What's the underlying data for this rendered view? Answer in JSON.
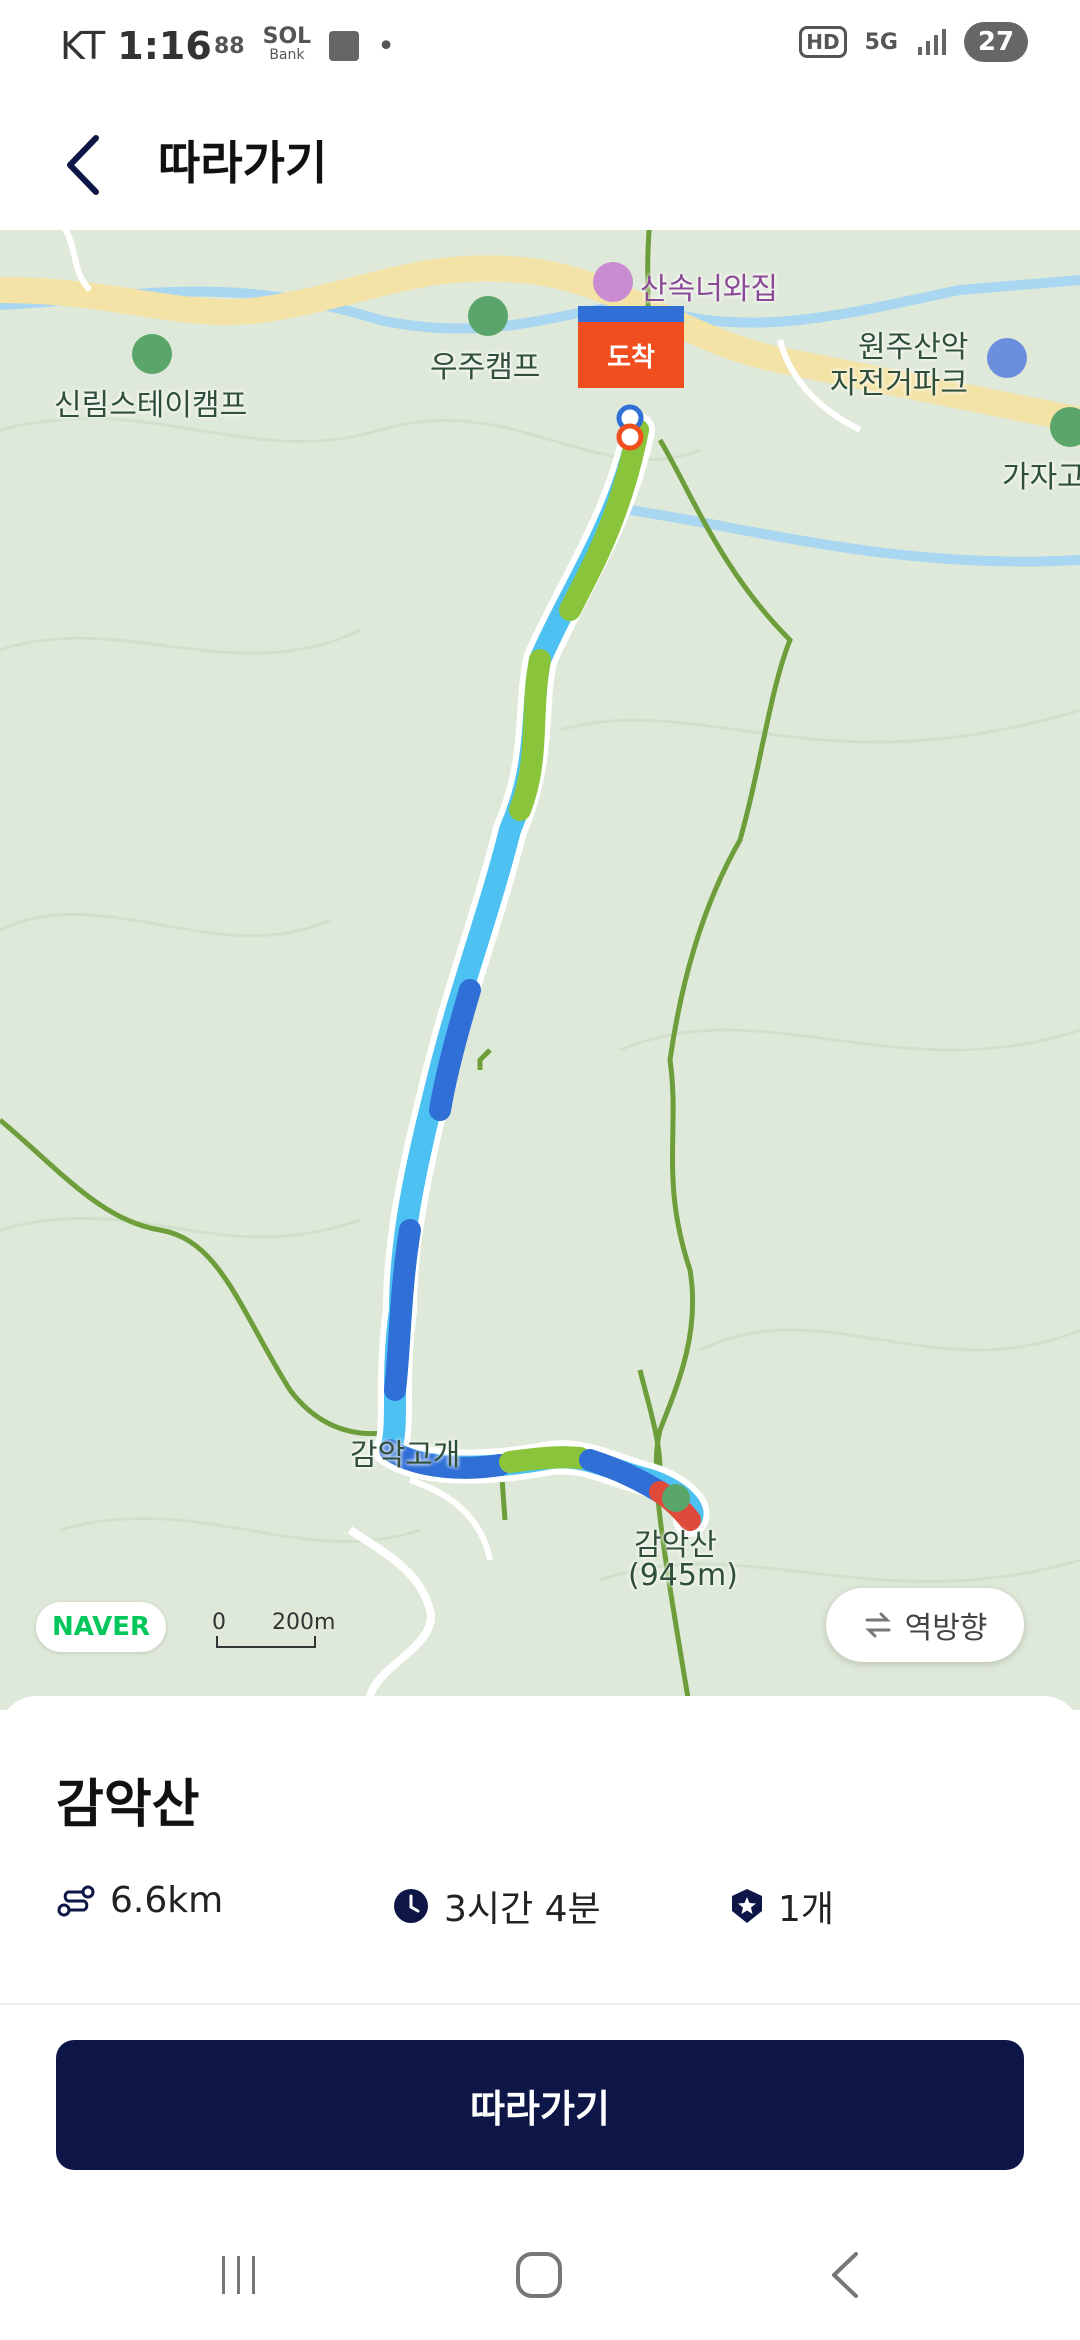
{
  "status_bar": {
    "carrier": "KT",
    "time": "1:16",
    "bank_text": "SOL",
    "bank_sub": "Bank",
    "dot": "•",
    "hd": "HD",
    "network": "5G",
    "battery": "27"
  },
  "header": {
    "back_icon": "chevron-left-icon",
    "title": "따라가기"
  },
  "map": {
    "labels": {
      "pension": "산속너와집",
      "camp_woojoo": "우주캠프",
      "camp_sinrim": "신림스테이캠프",
      "park_line1": "원주산악",
      "park_line2": "자전거파크",
      "gajago": "가자고",
      "pass": "감악고개",
      "summit": "감악산",
      "summit_elev": "(945m)"
    },
    "arrival_flag": "도착",
    "naver_logo": "NAVER",
    "scale_zero": "0",
    "scale_distance": "200m",
    "reverse_button": "역방향",
    "colors": {
      "map_bg": "#dfe9d9",
      "road": "#f4e3a6",
      "river": "#a9d6f0",
      "trail_green": "#6e9e3b",
      "route_blue": "#2f6fd6",
      "route_cyan": "#4cc1f2",
      "route_lime": "#8ac43a",
      "flag_red": "#f04e1e"
    }
  },
  "course": {
    "name": "감악산",
    "distance": "6.6km",
    "duration": "3시간 4분",
    "stamps": "1개"
  },
  "cta": {
    "label": "따라가기"
  },
  "nav": {
    "recent_icon": "recent-apps-icon",
    "home_icon": "home-icon",
    "back_icon": "back-icon"
  }
}
